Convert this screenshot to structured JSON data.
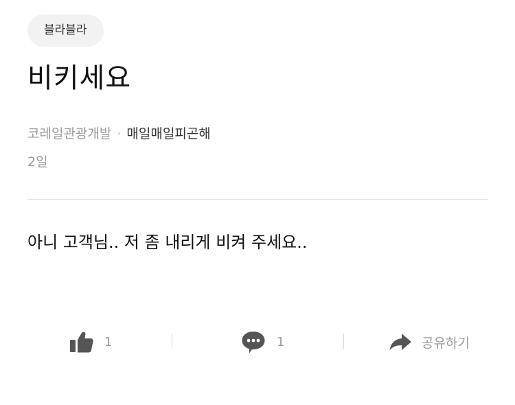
{
  "category_chip": "블라블라",
  "post": {
    "title": "비키세요",
    "company": "코레일관광개발",
    "separator": "·",
    "author": "매일매일피곤해",
    "time_ago": "2일",
    "content": "아니 고객님.. 저 좀 내리게 비켜 주세요.."
  },
  "actions": {
    "like": {
      "icon": "thumbs-up-icon",
      "count": "1"
    },
    "comment": {
      "icon": "speech-bubble-icon",
      "count": "1"
    },
    "share": {
      "icon": "share-arrow-icon",
      "label": "공유하기"
    }
  },
  "colors": {
    "text_primary": "#111111",
    "text_muted": "#9a9a9a",
    "icon_gray": "#555555",
    "chip_bg": "#f2f2f2",
    "divider": "#e4e4e4"
  }
}
